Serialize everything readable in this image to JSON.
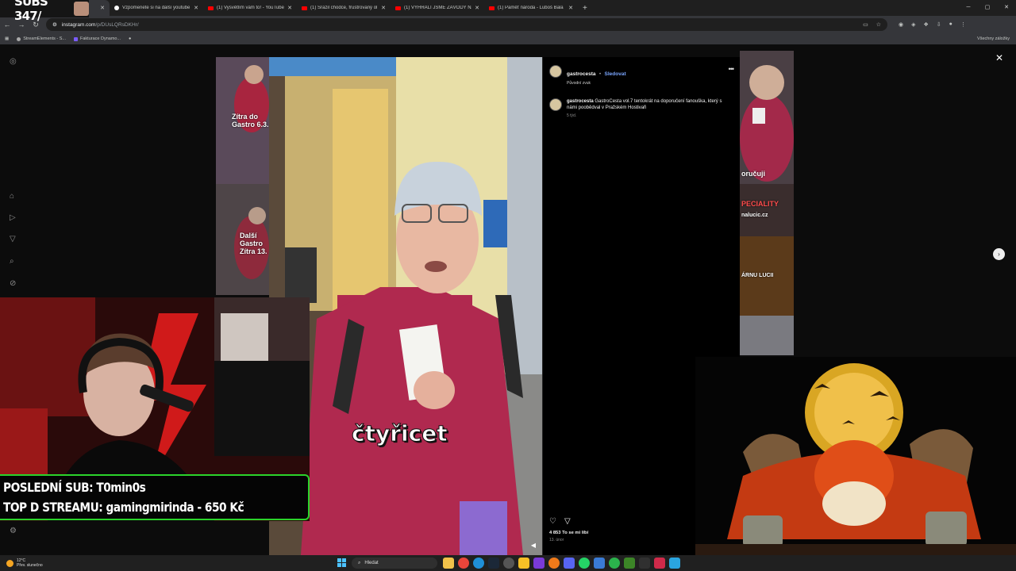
{
  "browser": {
    "tabs": [
      {
        "title": "",
        "icon": "tiktok-icon"
      },
      {
        "title": "Vzpomenete si na další youtube",
        "icon": "tiktok-icon"
      },
      {
        "title": "(1) Vysvětlím vám to! - YouTube",
        "icon": "youtube-icon"
      },
      {
        "title": "(1) Srazil chodce, frustrovaný ol",
        "icon": "youtube-icon"
      },
      {
        "title": "(1) VYHRÁLI JSME ZÁVODY NA",
        "icon": "youtube-icon"
      },
      {
        "title": "(1) Paměť národa - Luboš Bala",
        "icon": "youtube-icon"
      }
    ],
    "new_tab": "+",
    "url_domain": "instagram.com",
    "url_path": "/p/DUsLQRsDKHr/",
    "bookmarks": [
      {
        "label": "StreamElements - S..."
      },
      {
        "label": "Fakturace Dynamo..."
      }
    ],
    "all_bookmarks": "Všechny záložky"
  },
  "overlay": {
    "subs_counter": "SUBS 347/",
    "last_sub": "POSLEDNÍ SUB: T0min0s",
    "top_donation": "TOP D STREAMU: gamingmirinda - 650 Kč"
  },
  "post": {
    "username": "gastrocesta",
    "follow_label": "Sledovat",
    "audio_label": "Původní zvuk",
    "caption_user": "gastrocesta",
    "caption_text": "GastroCesta vol.7 tentokrát na doporučení fanouška, který s námi poobědval v Pražském Hostivaři",
    "caption_time": "5 týd.",
    "likes": "4 853 To se mi líbí",
    "date": "13. únor",
    "subtitle": "čtyřicet"
  },
  "bg_thumbs": {
    "left_top": "Zítra do Gastro 6.3.",
    "left_bottom": "Další Gastro Zítra 13.",
    "right_top": "oručuji",
    "right_mid": "PECIALITY",
    "right_mid2": "nalucic.cz",
    "right_lower": "ÁRNU LUCII"
  },
  "taskbar": {
    "temp": "12°C",
    "weather": "Přev. slunečno",
    "search": "Hledat"
  },
  "colors": {
    "follow": "#7aa6ff",
    "overlay_border": "#2bd32b",
    "coat": "#b0294f"
  }
}
